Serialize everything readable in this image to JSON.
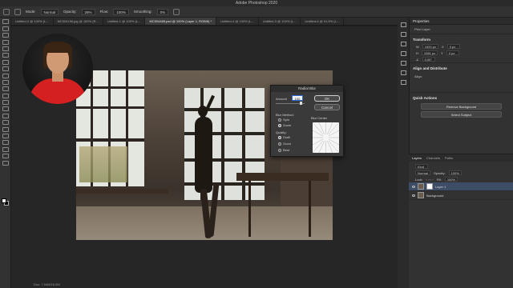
{
  "app": {
    "title": "Adobe Photoshop 2020"
  },
  "options": {
    "mode_label": "Mode:",
    "mode_value": "Normal",
    "opacity_label": "Opacity:",
    "opacity_value": "26%",
    "flow_label": "Flow:",
    "flow_value": "100%",
    "smoothing_label": "Smoothing:",
    "smoothing_value": "0%"
  },
  "tabs": [
    {
      "label": "Untitled-2 @ 100% (L..."
    },
    {
      "label": "MC004156.jpg @ 100% (R..."
    },
    {
      "label": "Untitled-1 @ 100% (L..."
    },
    {
      "label": "MC004465.psd @ 100% (Layer 1, RGB/8) *"
    },
    {
      "label": "Untitled-4 @ 100% (L..."
    },
    {
      "label": "Untitled-3 @ 100% (L..."
    },
    {
      "label": "Untitled-6 @ 91,5% (L..."
    }
  ],
  "status": {
    "doc": "Doc: 7,94M/15,9M"
  },
  "dialog": {
    "title": "Radial Blur",
    "amount_label": "Amount",
    "amount_value": "100",
    "ok": "OK",
    "cancel": "Cancel",
    "blur_method_label": "Blur Method:",
    "methods": [
      "Spin",
      "Zoom"
    ],
    "quality_label": "Quality:",
    "qualities": [
      "Draft",
      "Good",
      "Best"
    ],
    "blur_center_label": "Blur Center"
  },
  "properties": {
    "header": "Properties",
    "sub": "Pixel Layer",
    "transform_title": "Transform",
    "w": "1920 px",
    "x": "0 px",
    "h": "1081 px",
    "y": "0 px",
    "angle": "0,00°",
    "align_title": "Align and Distribute",
    "align_label": "Align:",
    "quick_title": "Quick Actions",
    "remove_bg": "Remove Background",
    "select_subject": "Select Subject"
  },
  "layers": {
    "tabs": [
      "Layers",
      "Channels",
      "Paths"
    ],
    "kind": "Kind",
    "blend": "Normal",
    "opacity_label": "Opacity:",
    "opacity": "100%",
    "lock_label": "Lock:",
    "fill_label": "Fill:",
    "fill": "100%",
    "items": [
      {
        "name": "Layer 1"
      },
      {
        "name": "Background"
      }
    ]
  }
}
